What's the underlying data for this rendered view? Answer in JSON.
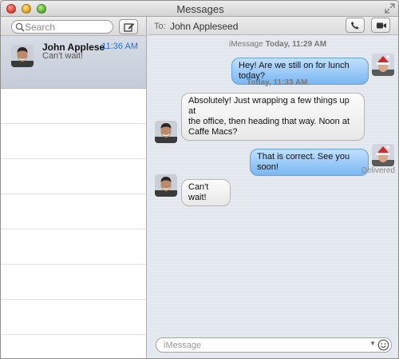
{
  "window": {
    "title": "Messages"
  },
  "sidebar": {
    "search_placeholder": "Search",
    "conversation": {
      "name": "John Appleseed",
      "time": "11:36 AM",
      "preview": "Can't wait!"
    }
  },
  "header": {
    "to_label": "To:",
    "to_name": "John Appleseed"
  },
  "thread": {
    "timestamp1_service": "iMessage",
    "timestamp1_time": "Today, 11:29 AM",
    "timestamp2": "Today, 11:33 AM",
    "messages": [
      {
        "from": "me",
        "text": "Hey! Are we still on for lunch today?"
      },
      {
        "from": "them",
        "lines": [
          "Absolutely! Just wrapping a few things up at",
          "the office, then heading that way. Noon at",
          "Caffe Macs?"
        ]
      },
      {
        "from": "me",
        "text": "That is correct. See you soon!"
      },
      {
        "from": "them",
        "text": "Can't wait!"
      }
    ],
    "delivered": "Delivered"
  },
  "composer": {
    "placeholder": "iMessage"
  },
  "colors": {
    "sent_bubble": "#7ab7f2",
    "received_bubble": "#e8e8e8",
    "time_accent": "#2a6ecf"
  },
  "icons": {
    "search": "search-icon",
    "compose": "compose-icon",
    "phone": "phone-icon",
    "video": "video-camera-icon",
    "emoji": "smiley-icon",
    "fullscreen": "fullscreen-icon"
  }
}
